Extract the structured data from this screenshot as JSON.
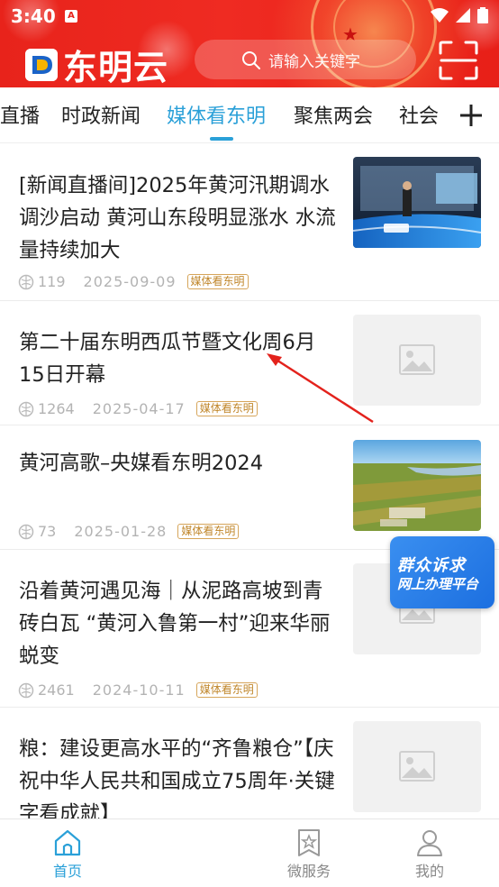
{
  "status_bar": {
    "time": "3:40",
    "badge": "A"
  },
  "header": {
    "logo_text": "东明云",
    "search_placeholder": "请输入关键字",
    "scan_icon": "scan-icon",
    "brand_color": "#e8231b"
  },
  "tabs": {
    "items": [
      "直播",
      "时政新闻",
      "媒体看东明",
      "聚焦两会",
      "社会"
    ],
    "active_index": 2,
    "active_color": "#2aa0d8",
    "add_icon": "plus-icon"
  },
  "news": [
    {
      "title": "[新闻直播间]2025年黄河汛期调水调沙启动 黄河山东段明显涨水 水流量持续加大",
      "views": "119",
      "date": "2025-09-09",
      "tag": "媒体看东明",
      "thumb": "cctv-studio-image"
    },
    {
      "title": "第二十届东明西瓜节暨文化周6月15日开幕",
      "views": "1264",
      "date": "2025-04-17",
      "tag": "媒体看东明",
      "thumb": "image-placeholder"
    },
    {
      "title": "黄河高歌–央媒看东明2024",
      "views": "73",
      "date": "2025-01-28",
      "tag": "媒体看东明",
      "thumb": "aerial-farmland-image"
    },
    {
      "title": "沿着黄河遇见海｜从泥路高坡到青砖白瓦 “黄河入鲁第一村”迎来华丽蜕变",
      "views": "2461",
      "date": "2024-10-11",
      "tag": "媒体看东明",
      "thumb": "image-placeholder"
    },
    {
      "title": "粮：建设更高水平的“齐鲁粮仓”【庆祝中华人民共和国成立75周年·关键字看成就】",
      "views": "",
      "date": "",
      "tag": "",
      "thumb": "image-placeholder"
    }
  ],
  "float_badge": {
    "line1": "群众诉求",
    "line2": "网上办理平台"
  },
  "bottom_nav": {
    "items": [
      {
        "label": "首页",
        "icon": "home-icon"
      },
      {
        "label": "微服务",
        "icon": "star-bookmark-icon"
      },
      {
        "label": "我的",
        "icon": "user-icon"
      }
    ],
    "active_index": 0
  }
}
